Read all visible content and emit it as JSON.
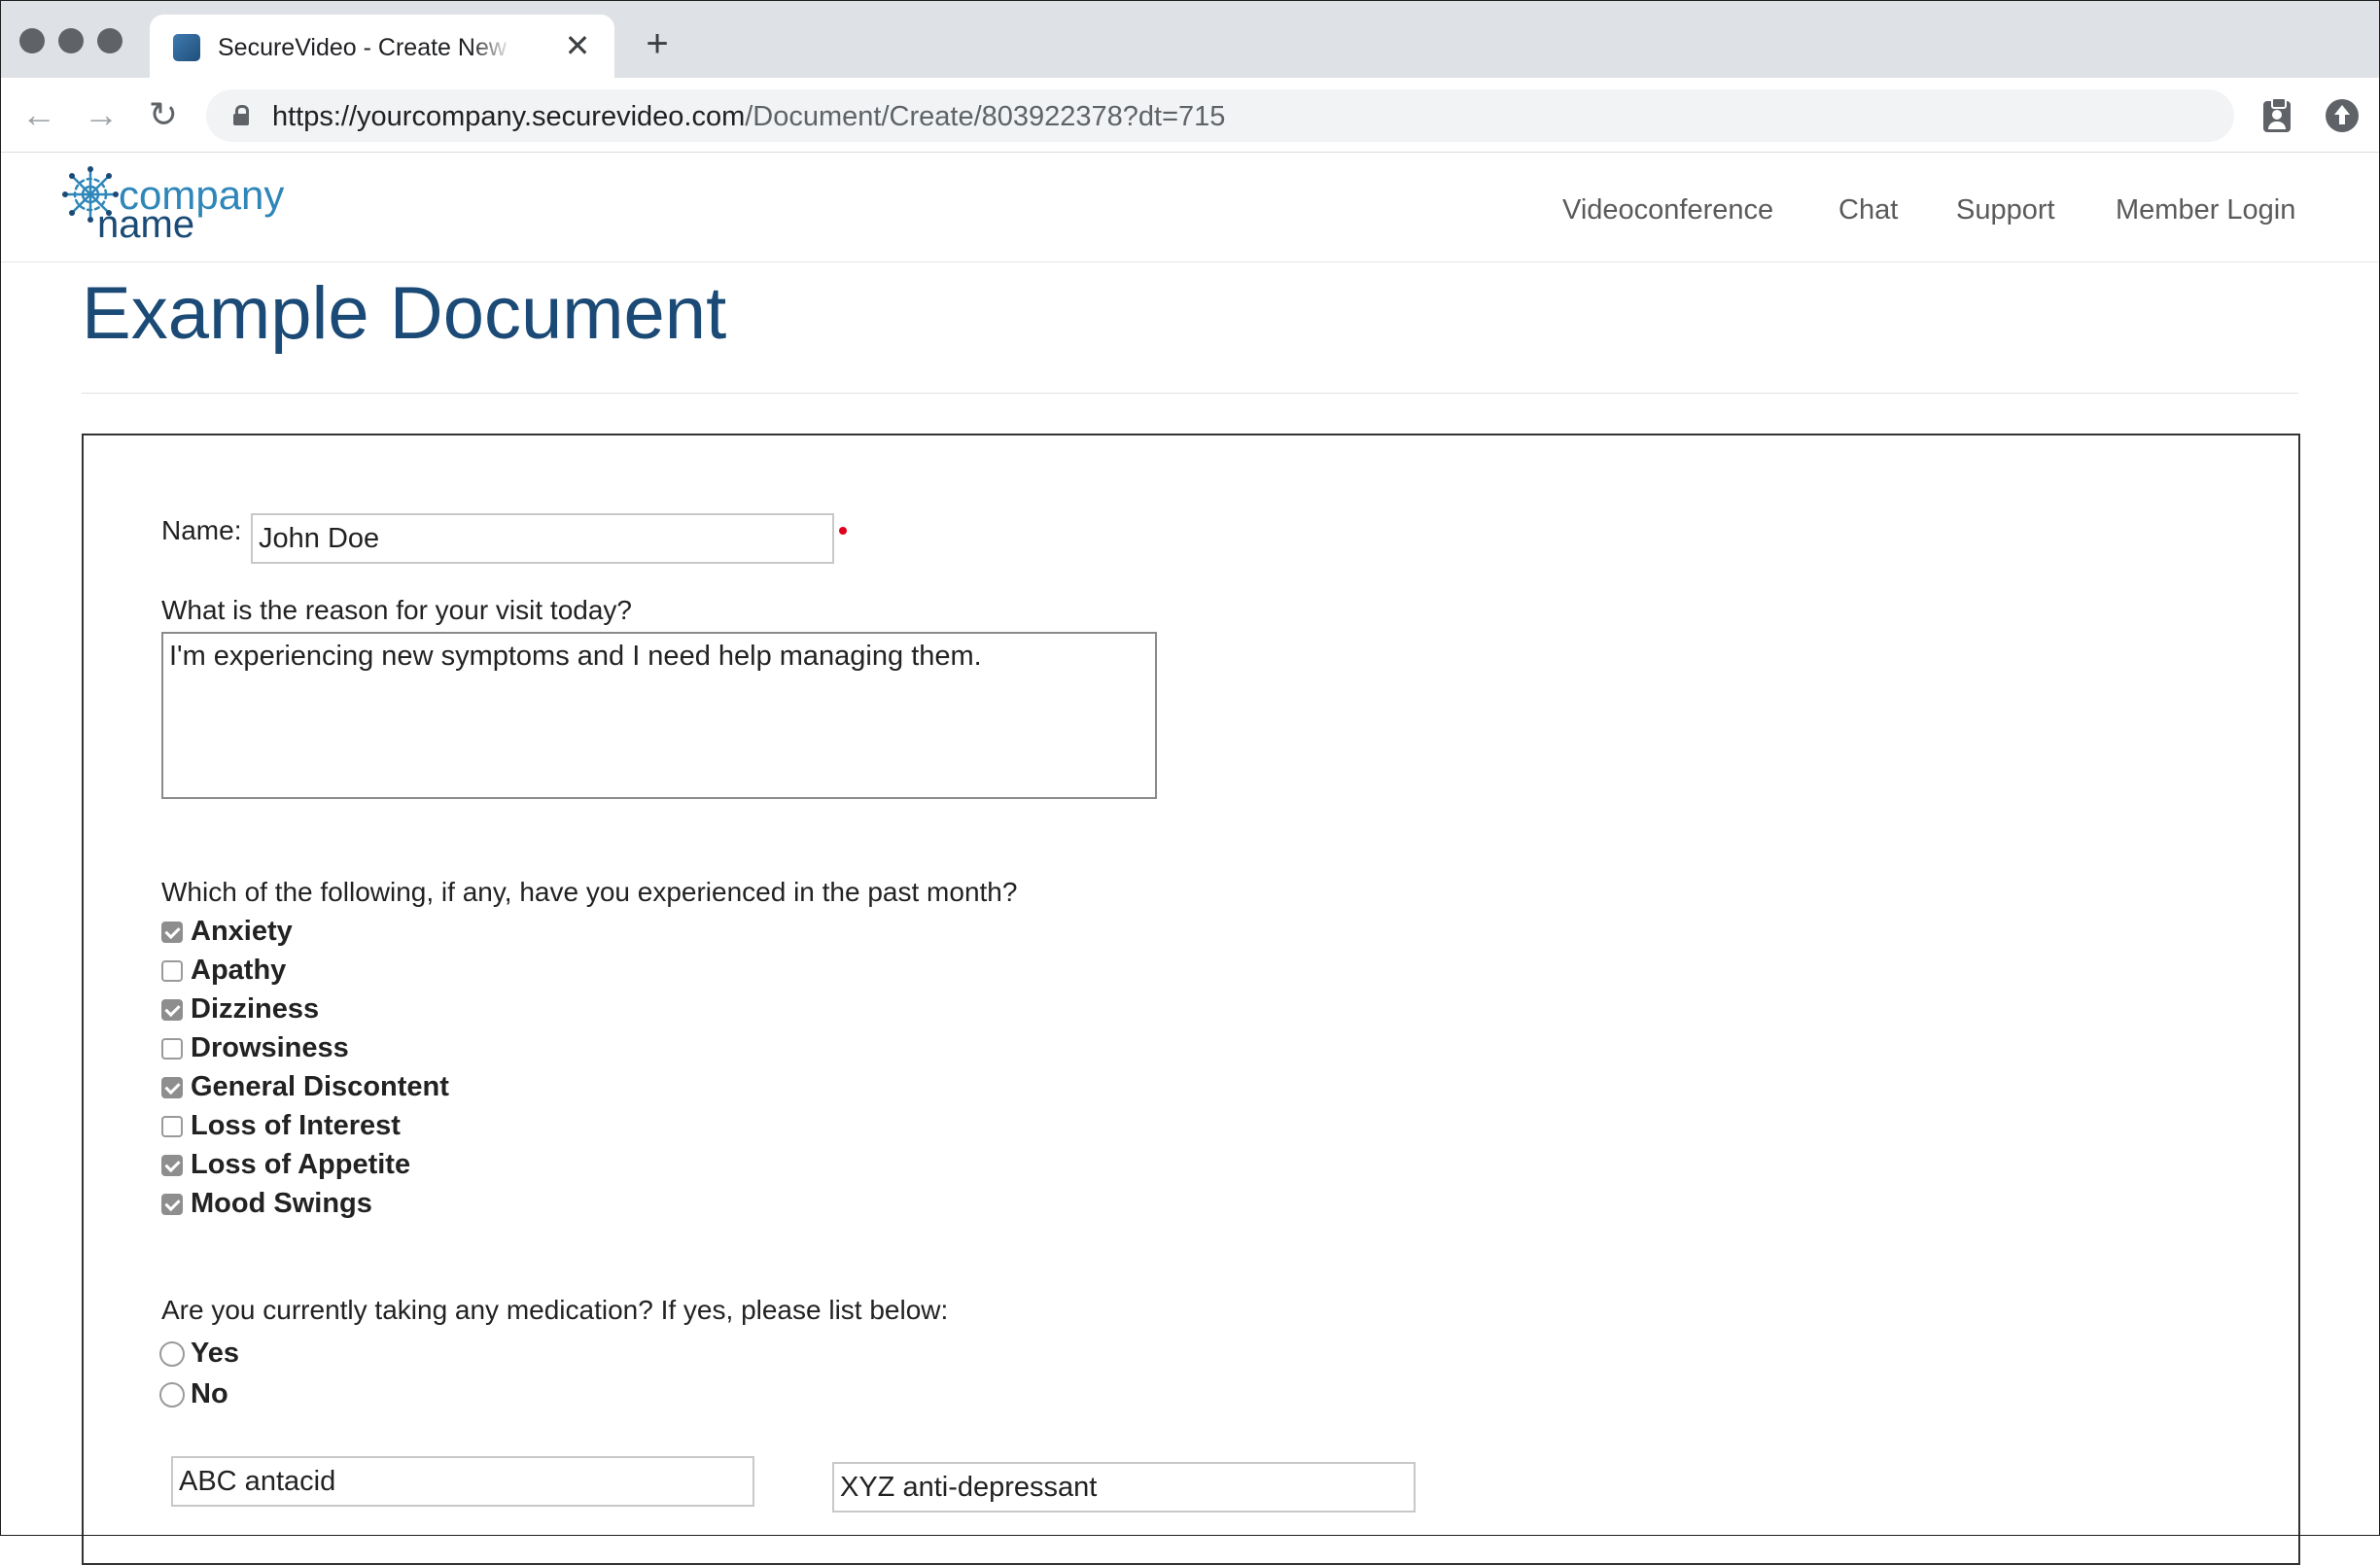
{
  "browser": {
    "tab_title": "SecureVideo - Create New Example Document",
    "tab_close": "✕",
    "new_tab": "+",
    "url_host": "https://yourcompany.securevideo.com",
    "url_path": "/Document/Create/803922378?dt=715",
    "nav_back": "←",
    "nav_forward": "→",
    "nav_reload": "↻"
  },
  "site": {
    "logo_word1": "company",
    "logo_word2": "name",
    "nav": {
      "videoconference": "Videoconference",
      "chat": "Chat",
      "support": "Support",
      "member_login": "Member Login"
    }
  },
  "page": {
    "title": "Example Document"
  },
  "form": {
    "name_label": "Name:",
    "name_value": "John Doe",
    "reason_label": "What is the reason for your visit today?",
    "reason_value": "I'm experiencing new symptoms and I need help managing them.",
    "symptoms_label": "Which of the following, if any, have you experienced in the past month?",
    "symptoms": [
      {
        "label": "Anxiety",
        "checked": true
      },
      {
        "label": "Apathy",
        "checked": false
      },
      {
        "label": "Dizziness",
        "checked": true
      },
      {
        "label": "Drowsiness",
        "checked": false
      },
      {
        "label": "General Discontent",
        "checked": true
      },
      {
        "label": "Loss of Interest",
        "checked": false
      },
      {
        "label": "Loss of Appetite",
        "checked": true
      },
      {
        "label": "Mood Swings",
        "checked": true
      }
    ],
    "medication_label": "Are you currently taking any medication? If yes, please list below:",
    "medication_options": [
      {
        "label": "Yes",
        "selected": false
      },
      {
        "label": "No",
        "selected": false
      }
    ],
    "medication_1": "ABC antacid",
    "medication_2": "XYZ anti-depressant"
  }
}
